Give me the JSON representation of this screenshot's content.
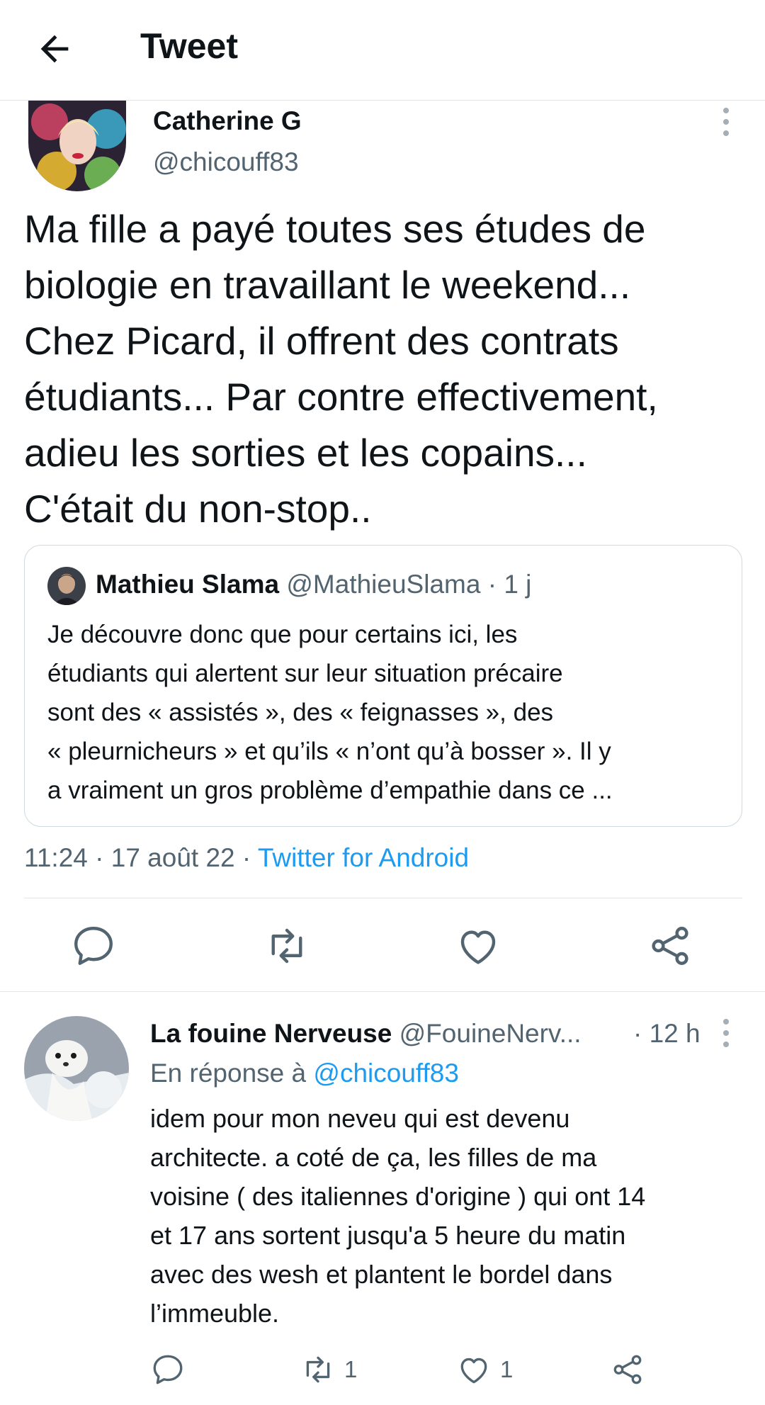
{
  "header": {
    "title": "Tweet"
  },
  "tweet": {
    "author_name": "Catherine G",
    "author_handle": "@chicouff83",
    "text": "Ma fille a payé toutes ses études de\nbiologie en travaillant le weekend...\nChez Picard, il offrent des contrats\nétudiants... Par contre effectivement,\nadieu les sorties et les copains...\nC'était du non-stop..",
    "time": "11:24",
    "date": "17 août 22",
    "source": "Twitter for Android"
  },
  "quote": {
    "author_name": "Mathieu Slama",
    "author_handle": "@MathieuSlama",
    "age": "1 j",
    "text": "Je découvre donc que pour certains ici, les\nétudiants qui alertent sur leur situation précaire\nsont des « assistés », des « feignasses », des\n« pleurnicheurs » et qu’ils « n’ont qu’à bosser ». Il y\na vraiment un gros problème d’empathie dans ce ..."
  },
  "reply": {
    "author_name": "La fouine Nerveuse",
    "author_handle": "@FouineNerv...",
    "age": "· 12 h",
    "in_reply_label": "En réponse à",
    "in_reply_handle": "@chicouff83",
    "text": "idem pour mon neveu qui est devenu\narchitecte. a coté de ça, les filles de ma\nvoisine ( des italiennes d'origine ) qui ont 14\net 17 ans sortent jusqu'a 5 heure du matin\navec des wesh et plantent le bordel dans\nl’immeuble.",
    "retweet_count": "1",
    "like_count": "1"
  },
  "icons": {
    "back": "arrow-left-icon",
    "more": "more-vertical-icon",
    "reply": "comment-icon",
    "retweet": "retweet-icon",
    "like": "heart-icon",
    "share": "share-icon"
  },
  "colors": {
    "link": "#1d9bf0",
    "secondary": "#536471",
    "text": "#0f1419",
    "divider": "#e1e4e8"
  }
}
